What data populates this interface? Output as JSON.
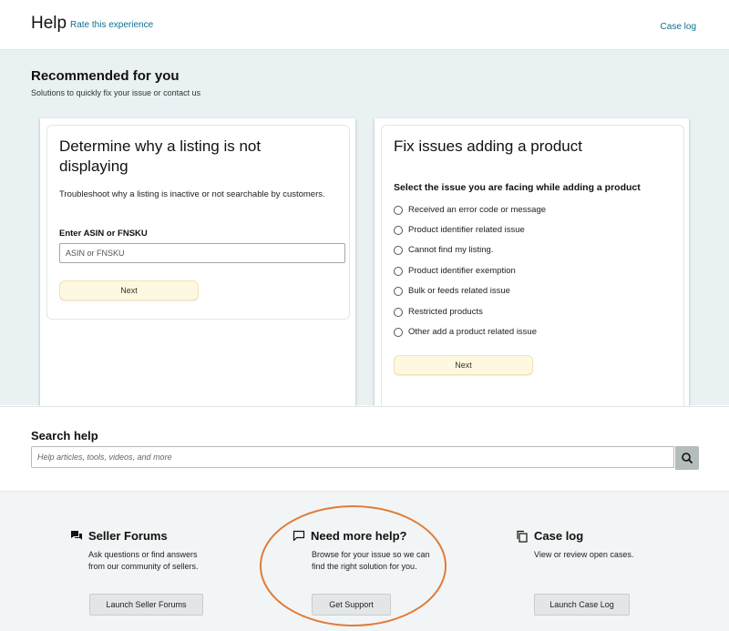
{
  "header": {
    "title": "Help",
    "rate_link": "Rate this experience",
    "case_log_link": "Case log"
  },
  "recommended": {
    "heading": "Recommended for you",
    "subheading": "Solutions to quickly fix your issue or contact us",
    "card1": {
      "title": "Determine why a listing is not displaying",
      "description": "Troubleshoot why a listing is inactive or not searchable by customers.",
      "field_label": "Enter ASIN or FNSKU",
      "field_placeholder": "ASIN or FNSKU",
      "button": "Next"
    },
    "card2": {
      "title": "Fix issues adding a product",
      "question": "Select the issue you are facing while adding a product",
      "options": [
        "Received an error code or message",
        "Product identifier related issue",
        "Cannot find my listing.",
        "Product identifier exemption",
        "Bulk or feeds related issue",
        "Restricted products",
        "Other add a product related issue"
      ],
      "button": "Next"
    }
  },
  "search": {
    "heading": "Search help",
    "placeholder": "Help articles, tools, videos, and more",
    "icon": "search-icon"
  },
  "support": {
    "forums": {
      "title": "Seller Forums",
      "description_line1": "Ask questions or find answers",
      "description_line2": "from our community of sellers.",
      "button": "Launch Seller Forums",
      "icon": "forum-icon"
    },
    "help": {
      "title": "Need more help?",
      "description_line1": "Browse for your issue so we can",
      "description_line2": "find the right solution for you.",
      "button": "Get Support",
      "icon": "chat-bubble-icon"
    },
    "caselog": {
      "title": "Case log",
      "description_line1": "View or review open cases.",
      "button": "Launch Case Log",
      "icon": "copy-icon"
    }
  },
  "colors": {
    "highlight_circle": "#e07b3a",
    "link": "#0f6f8f",
    "recommended_bg": "#e9f1f3"
  }
}
